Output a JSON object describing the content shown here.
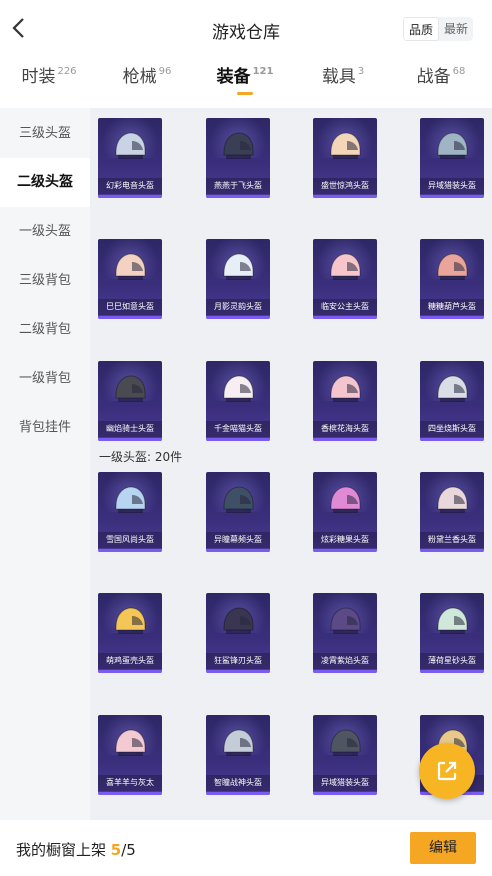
{
  "header": {
    "title": "游戏仓库",
    "sort_options": [
      "品质",
      "最新"
    ],
    "sort_selected": "品质"
  },
  "tabs": [
    {
      "label": "时装",
      "count": "226"
    },
    {
      "label": "枪械",
      "count": "96"
    },
    {
      "label": "装备",
      "count": "121"
    },
    {
      "label": "载具",
      "count": "3"
    },
    {
      "label": "战备",
      "count": "68"
    }
  ],
  "sidebar": [
    "三级头盔",
    "二级头盔",
    "一级头盔",
    "三级背包",
    "二级背包",
    "一级背包",
    "背包挂件"
  ],
  "sidebar_active": "二级头盔",
  "section_level1": "一级头盔: 20件",
  "items_level2": [
    {
      "name": "幻彩电音头盔",
      "icon": "helmet-icon",
      "color": "#c9d3e6"
    },
    {
      "name": "燕燕于飞头盔",
      "icon": "helmet-icon",
      "color": "#3a3f55"
    },
    {
      "name": "盛世惊鸿头盔",
      "icon": "helmet-icon",
      "color": "#f3d6b8"
    },
    {
      "name": "异域猎装头盔",
      "icon": "helmet-icon",
      "color": "#9fb4c4"
    },
    {
      "name": "巳巳如意头盔",
      "icon": "helmet-icon",
      "color": "#f4d2c2"
    },
    {
      "name": "月影灵韵头盔",
      "icon": "helmet-icon",
      "color": "#e8eef6"
    },
    {
      "name": "临安公主头盔",
      "icon": "helmet-icon",
      "color": "#f6c6cc"
    },
    {
      "name": "糖糖葫芦头盔",
      "icon": "helmet-icon",
      "color": "#e9a59a"
    },
    {
      "name": "幽焰骑士头盔",
      "icon": "helmet-icon",
      "color": "#4a4a52"
    },
    {
      "name": "千金喵猫头盔",
      "icon": "helmet-icon",
      "color": "#f7eef2"
    },
    {
      "name": "香槟花海头盔",
      "icon": "helmet-icon",
      "color": "#f4c4cf"
    },
    {
      "name": "四坐烧斯头盔",
      "icon": "helmet-icon",
      "color": "#d8dde6"
    }
  ],
  "items_level1": [
    {
      "name": "雪国风尚头盔",
      "icon": "helmet-icon",
      "color": "#b7d4f1"
    },
    {
      "name": "异瞳幕频头盔",
      "icon": "helmet-icon",
      "color": "#3e4f66"
    },
    {
      "name": "炫彩糖果头盔",
      "icon": "helmet-icon",
      "color": "#e08ad6"
    },
    {
      "name": "粉黛兰香头盔",
      "icon": "helmet-icon",
      "color": "#e8d8dc"
    },
    {
      "name": "萌鸡蛋壳头盔",
      "icon": "helmet-icon",
      "color": "#f3c655"
    },
    {
      "name": "狂鲨锋刃头盔",
      "icon": "helmet-icon",
      "color": "#3a3550"
    },
    {
      "name": "凌霄紫焰头盔",
      "icon": "helmet-icon",
      "color": "#5c4a86"
    },
    {
      "name": "薄荷星砂头盔",
      "icon": "helmet-icon",
      "color": "#cfe8d9"
    },
    {
      "name": "喜羊羊与灰太",
      "icon": "helmet-icon",
      "color": "#f3c9d2"
    },
    {
      "name": "智瞳战神头盔",
      "icon": "helmet-icon",
      "color": "#c4ccd8"
    },
    {
      "name": "异域猎装头盔",
      "icon": "helmet-icon",
      "color": "#4f5661"
    },
    {
      "name": ")",
      "icon": "helmet-icon",
      "color": "#e8c98a"
    }
  ],
  "bottom": {
    "label": "我的橱窗上架 ",
    "current": "5",
    "total": "/5",
    "edit_label": "编辑"
  },
  "icons": {
    "back": "back-arrow-icon",
    "share": "share-icon"
  },
  "colors": {
    "accent": "#f5a623",
    "card": "#2d2766"
  }
}
